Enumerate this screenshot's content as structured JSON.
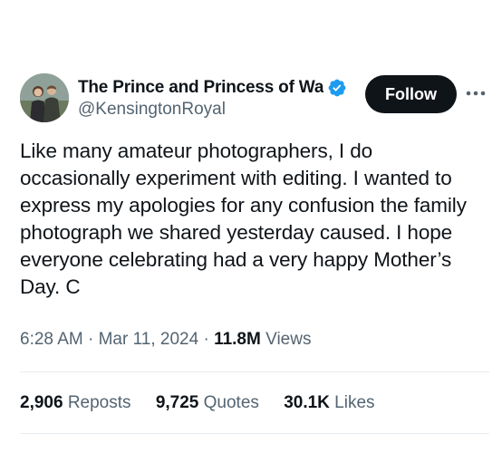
{
  "author": {
    "display_name": "The Prince and Princess of Wa",
    "handle": "@KensingtonRoyal",
    "avatar_icon": "profile-photo",
    "verified_icon": "verified-badge-icon",
    "verified_color": "#1d9bf0"
  },
  "follow_label": "Follow",
  "more_icon": "more-options-icon",
  "body_lines": [
    "Like many amateur photographers, I do",
    "occasionally experiment with editing. I wanted to",
    "express my apologies for any confusion the family",
    "photograph we shared yesterday caused. I hope",
    "everyone celebrating had a very happy Mother’s",
    "Day. C"
  ],
  "meta": {
    "time": "6:28 AM",
    "sep1": "·",
    "date": "Mar 11, 2024",
    "sep2": "·",
    "views_count": "11.8M",
    "views_label": "Views"
  },
  "stats": [
    {
      "count": "2,906",
      "label": "Reposts"
    },
    {
      "count": "9,725",
      "label": "Quotes"
    },
    {
      "count": "30.1K",
      "label": "Likes"
    }
  ],
  "colors": {
    "text_primary": "#0f1419",
    "text_secondary": "#536471",
    "button_bg": "#0f1419",
    "divider": "#e6ecf0"
  }
}
